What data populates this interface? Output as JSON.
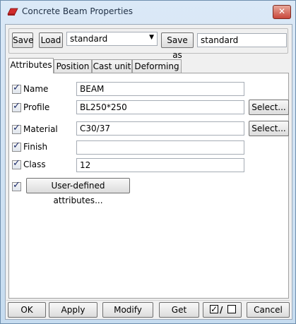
{
  "window": {
    "title": "Concrete Beam Properties",
    "close_symbol": "✕"
  },
  "toolbar": {
    "save_label": "Save",
    "load_label": "Load",
    "preset_value": "standard",
    "save_as_label": "Save as",
    "save_as_value": "standard"
  },
  "tabs": [
    {
      "label": "Attributes"
    },
    {
      "label": "Position"
    },
    {
      "label": "Cast unit"
    },
    {
      "label": "Deforming"
    }
  ],
  "attributes": {
    "name": {
      "label": "Name",
      "value": "BEAM"
    },
    "profile": {
      "label": "Profile",
      "value": "BL250*250",
      "select_label": "Select..."
    },
    "material": {
      "label": "Material",
      "value": "C30/37",
      "select_label": "Select..."
    },
    "finish": {
      "label": "Finish",
      "value": ""
    },
    "class": {
      "label": "Class",
      "value": "12"
    },
    "user_defined_label": "User-defined attributes..."
  },
  "footer": {
    "ok_label": "OK",
    "apply_label": "Apply",
    "modify_label": "Modify",
    "get_label": "Get",
    "toggle_separator": "/",
    "cancel_label": "Cancel"
  },
  "colors": {
    "title_bar": "#c6dcf0",
    "close_button": "#c9473a",
    "check_mark": "#1b2b6b"
  }
}
